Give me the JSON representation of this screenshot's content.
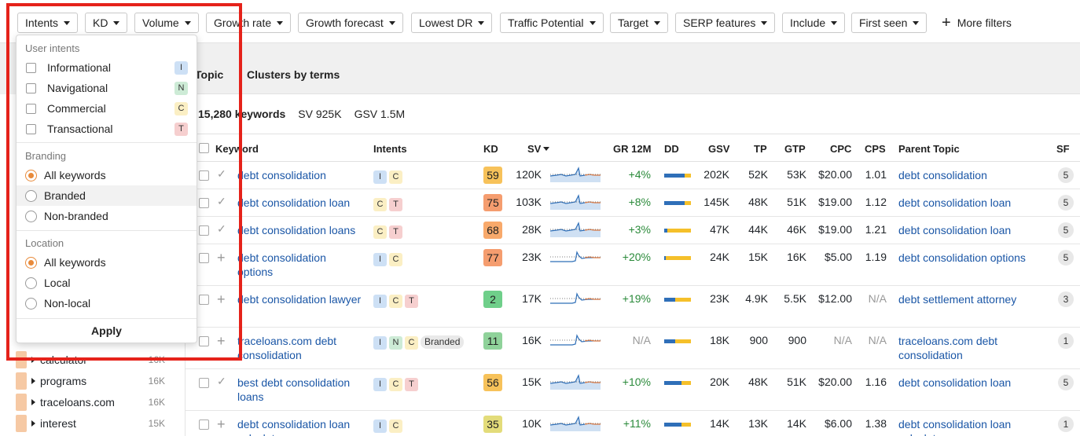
{
  "filters": [
    {
      "label": "Intents"
    },
    {
      "label": "KD"
    },
    {
      "label": "Volume"
    },
    {
      "label": "Growth rate"
    },
    {
      "label": "Growth forecast"
    },
    {
      "label": "Lowest DR"
    },
    {
      "label": "Traffic Potential"
    },
    {
      "label": "Target"
    },
    {
      "label": "SERP features"
    },
    {
      "label": "Include"
    },
    {
      "label": "First seen"
    }
  ],
  "more_filters": "More filters",
  "tabs": [
    "Topic",
    "Clusters by terms"
  ],
  "summary": {
    "keywords": "15,280 keywords",
    "sv": "SV 925K",
    "gsv": "GSV 1.5M"
  },
  "columns": [
    "Keyword",
    "Intents",
    "KD",
    "SV",
    "GR 12M",
    "DD",
    "GSV",
    "TP",
    "GTP",
    "CPC",
    "CPS",
    "Parent Topic",
    "SF"
  ],
  "rows": [
    {
      "keyword": "debt consolidation",
      "intents": [
        "I",
        "C"
      ],
      "branded": "",
      "kd": "59",
      "kd_color": "#f7c25a",
      "sv": "120K",
      "gr": "+4%",
      "gsv": "202K",
      "tp": "52K",
      "gtp": "53K",
      "cpc": "$20.00",
      "cps": "1.01",
      "parent": "debt consolidation",
      "sf": "5",
      "mark": "check"
    },
    {
      "keyword": "debt consolidation loan",
      "intents": [
        "C",
        "T"
      ],
      "branded": "",
      "kd": "75",
      "kd_color": "#f59d6f",
      "sv": "103K",
      "gr": "+8%",
      "gsv": "145K",
      "tp": "48K",
      "gtp": "51K",
      "cpc": "$19.00",
      "cps": "1.12",
      "parent": "debt consolidation loan",
      "sf": "5",
      "mark": "check"
    },
    {
      "keyword": "debt consolidation loans",
      "intents": [
        "C",
        "T"
      ],
      "branded": "",
      "kd": "68",
      "kd_color": "#f8a96b",
      "sv": "28K",
      "gr": "+3%",
      "gsv": "47K",
      "tp": "44K",
      "gtp": "46K",
      "cpc": "$19.00",
      "cps": "1.21",
      "parent": "debt consolidation loan",
      "sf": "5",
      "mark": "check"
    },
    {
      "keyword": "debt consolidation options",
      "intents": [
        "I",
        "C"
      ],
      "branded": "",
      "kd": "77",
      "kd_color": "#f59d6f",
      "sv": "23K",
      "gr": "+20%",
      "gsv": "24K",
      "tp": "15K",
      "gtp": "16K",
      "cpc": "$5.00",
      "cps": "1.19",
      "parent": "debt consolidation options",
      "sf": "5",
      "mark": "plus"
    },
    {
      "keyword": "debt consolidation lawyer",
      "intents": [
        "I",
        "C",
        "T"
      ],
      "branded": "",
      "kd": "2",
      "kd_color": "#6fcf8a",
      "sv": "17K",
      "gr": "+19%",
      "gsv": "23K",
      "tp": "4.9K",
      "gtp": "5.5K",
      "cpc": "$12.00",
      "cps": "N/A",
      "parent": "debt settlement attorney",
      "sf": "3",
      "mark": "plus"
    },
    {
      "keyword": "traceloans.com debt consolidation",
      "intents": [
        "I",
        "N",
        "C"
      ],
      "branded": "Branded",
      "kd": "11",
      "kd_color": "#8fd29a",
      "sv": "16K",
      "gr": "N/A",
      "gsv": "18K",
      "tp": "900",
      "gtp": "900",
      "cpc": "N/A",
      "cps": "N/A",
      "parent": "traceloans.com debt consolidation",
      "sf": "1",
      "mark": "plus"
    },
    {
      "keyword": "best debt consolidation loans",
      "intents": [
        "I",
        "C",
        "T"
      ],
      "branded": "",
      "kd": "56",
      "kd_color": "#f7c25a",
      "sv": "15K",
      "gr": "+10%",
      "gsv": "20K",
      "tp": "48K",
      "gtp": "51K",
      "cpc": "$20.00",
      "cps": "1.16",
      "parent": "debt consolidation loan",
      "sf": "5",
      "mark": "check"
    },
    {
      "keyword": "debt consolidation loan calculator",
      "intents": [
        "I",
        "C"
      ],
      "branded": "",
      "kd": "35",
      "kd_color": "#e3dc7a",
      "sv": "10K",
      "gr": "+11%",
      "gsv": "14K",
      "tp": "13K",
      "gtp": "14K",
      "cpc": "$6.00",
      "cps": "1.38",
      "parent": "debt consolidation loan calculator",
      "sf": "1",
      "mark": "plus"
    }
  ],
  "left_list": [
    {
      "label": "calculator",
      "count": "16K"
    },
    {
      "label": "programs",
      "count": "16K"
    },
    {
      "label": "traceloans.com",
      "count": "16K"
    },
    {
      "label": "interest",
      "count": "15K"
    }
  ],
  "dropdown": {
    "user_intents_title": "User intents",
    "intents": [
      {
        "label": "Informational",
        "badge": "I"
      },
      {
        "label": "Navigational",
        "badge": "N"
      },
      {
        "label": "Commercial",
        "badge": "C"
      },
      {
        "label": "Transactional",
        "badge": "T"
      }
    ],
    "branding_title": "Branding",
    "branding": [
      {
        "label": "All keywords",
        "selected": true
      },
      {
        "label": "Branded",
        "selected": false
      },
      {
        "label": "Non-branded",
        "selected": false
      }
    ],
    "location_title": "Location",
    "location": [
      {
        "label": "All keywords",
        "selected": true
      },
      {
        "label": "Local",
        "selected": false
      },
      {
        "label": "Non-local",
        "selected": false
      }
    ],
    "apply": "Apply"
  }
}
